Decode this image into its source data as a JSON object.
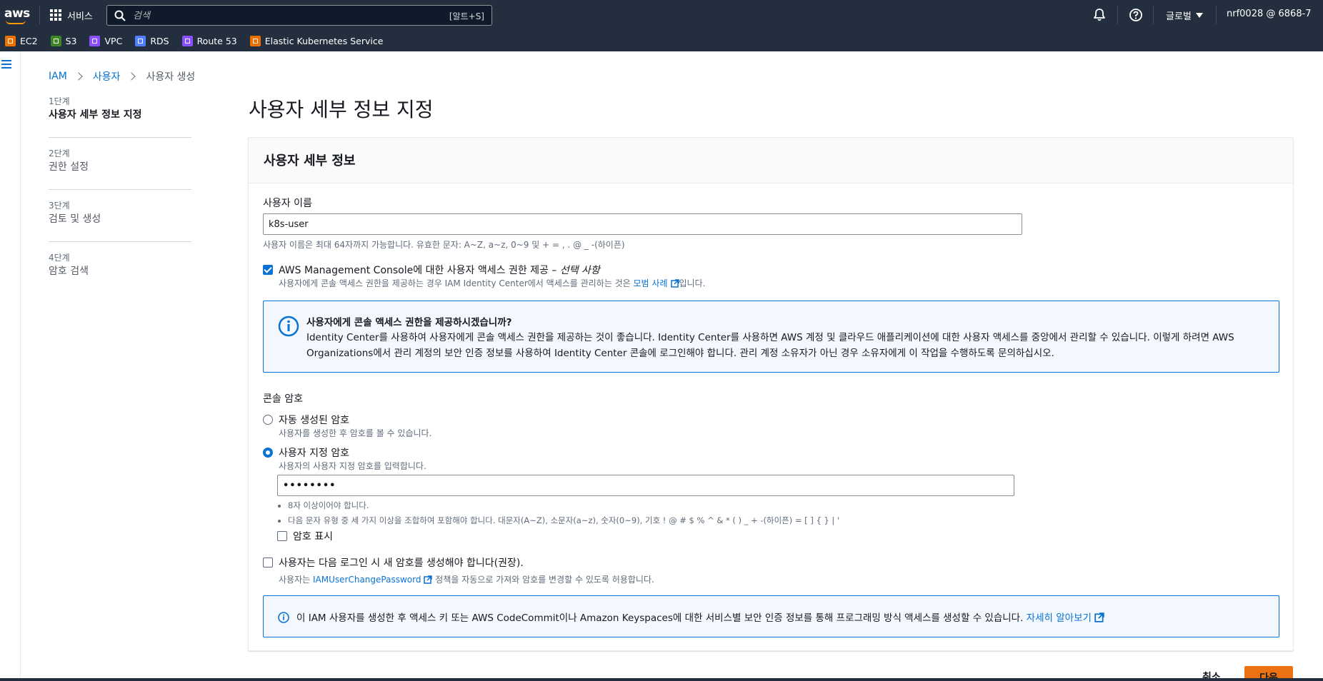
{
  "colors": {
    "nav_bg": "#232f3e",
    "link": "#0972d3",
    "primary_button": "#ec7211",
    "info_bg": "#f2f8fd"
  },
  "topnav": {
    "logo": "aws",
    "services_label": "서비스",
    "search_placeholder": "검색",
    "search_shortcut": "[알트+S]",
    "region": "글로벌",
    "account": "nrf0028 @ 6868-7",
    "icons": [
      "bell-icon",
      "help-icon"
    ]
  },
  "favorites": [
    {
      "label": "EC2",
      "color": "#ed7100"
    },
    {
      "label": "S3",
      "color": "#3f8624"
    },
    {
      "label": "VPC",
      "color": "#8c4fff"
    },
    {
      "label": "RDS",
      "color": "#527fff"
    },
    {
      "label": "Route 53",
      "color": "#8c4fff"
    },
    {
      "label": "Elastic Kubernetes Service",
      "color": "#ed7100"
    }
  ],
  "breadcrumb": {
    "root": "IAM",
    "middle": "사용자",
    "current": "사용자 생성"
  },
  "steps": [
    {
      "num": "1단계",
      "title": "사용자 세부 정보 지정"
    },
    {
      "num": "2단계",
      "title": "권한 설정"
    },
    {
      "num": "3단계",
      "title": "검토 및 생성"
    },
    {
      "num": "4단계",
      "title": "암호 검색"
    }
  ],
  "page_title": "사용자 세부 정보 지정",
  "section": {
    "title": "사용자 세부 정보",
    "username_label": "사용자 이름",
    "username_value": "k8s-user",
    "username_hint": "사용자 이름은 최대 64자까지 가능합니다. 유효한 문자: A~Z, a~z, 0~9 및 + = , . @ _ -(하이픈)",
    "console_access_label": "AWS Management Console에 대한 사용자 액세스 권한 제공 –",
    "console_access_optional": "선택 사항",
    "console_access_checked": true,
    "console_access_hint_prefix": "사용자에게 콘솔 액세스 권한을 제공하는 경우 IAM Identity Center에서 액세스를 관리하는 것은",
    "console_access_hint_link": "모범 사례",
    "console_access_hint_suffix": "입니다.",
    "info_title": "사용자에게 콘솔 액세스 권한을 제공하시겠습니까?",
    "info_body": "Identity Center를 사용하여 사용자에게 콘솔 액세스 권한을 제공하는 것이 좋습니다. Identity Center를 사용하면 AWS 계정 및 클라우드 애플리케이션에 대한 사용자 액세스를 중앙에서 관리할 수 있습니다. 이렇게 하려면 AWS Organizations에서 관리 계정의 보안 인증 정보를 사용하여 Identity Center 콘솔에 로그인해야 합니다. 관리 계정 소유자가 아닌 경우 소유자에게 이 작업을 수행하도록 문의하십시오.",
    "password_label": "콘솔 암호",
    "auto_password_label": "자동 생성된 암호",
    "auto_password_hint": "사용자를 생성한 후 암호를 볼 수 있습니다.",
    "custom_password_label": "사용자 지정 암호",
    "custom_password_hint": "사용자의 사용자 지정 암호를 입력합니다.",
    "custom_password_selected": true,
    "password_value": "••••••••",
    "rules": [
      "8자 이상이어야 합니다.",
      "다음 문자 유형 중 세 가지 이상을 조합하여 포함해야 합니다. 대문자(A~Z), 소문자(a~z), 숫자(0~9), 기호 ! @ # $ % ^ & * ( ) _ + -(하이픈) = [ ] { } | '"
    ],
    "show_password_label": "암호 표시",
    "must_reset_label": "사용자는 다음 로그인 시 새 암호를 생성해야 합니다(권장).",
    "must_reset_hint_prefix": "사용자는",
    "must_reset_hint_link": "IAMUserChangePassword",
    "must_reset_hint_suffix": "정책을 자동으로 가져와 암호를 변경할 수 있도록 허용합니다.",
    "bottom_info_text": "이 IAM 사용자를 생성한 후 액세스 키 또는 AWS CodeCommit이나 Amazon Keyspaces에 대한 서비스별 보안 인증 정보를 통해 프로그래밍 방식 액세스를 생성할 수 있습니다.",
    "bottom_info_link": "자세히 알아보기"
  },
  "footer": {
    "cancel": "취소",
    "next": "다음"
  }
}
